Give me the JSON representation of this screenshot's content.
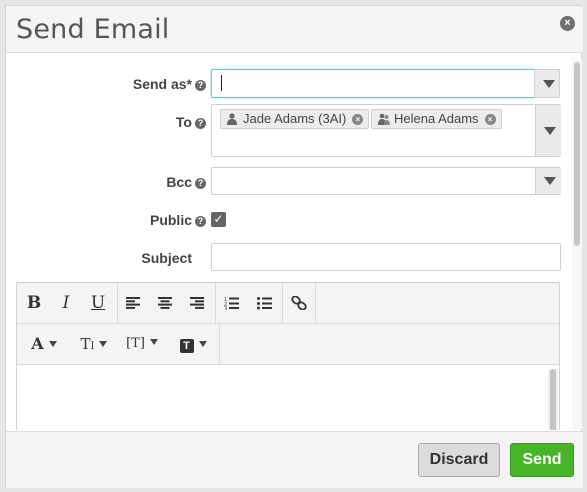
{
  "dialog": {
    "title": "Send Email",
    "close_icon": "close-icon"
  },
  "form": {
    "send_as": {
      "label": "Send as*",
      "value": ""
    },
    "to": {
      "label": "To",
      "recipients": [
        {
          "name": "Jade Adams (3AI)",
          "icon": "person-icon"
        },
        {
          "name": "Helena Adams",
          "icon": "group-icon"
        }
      ]
    },
    "bcc": {
      "label": "Bcc",
      "value": ""
    },
    "public": {
      "label": "Public",
      "checked": true
    },
    "subject": {
      "label": "Subject",
      "value": ""
    },
    "help_glyph": "?",
    "check_glyph": "✓",
    "remove_glyph": "×"
  },
  "toolbar": {
    "bold": "B",
    "italic": "I",
    "underline": "U",
    "font": "A",
    "text_size": "T",
    "insert_field": "[T]",
    "template": "T"
  },
  "footer": {
    "discard_label": "Discard",
    "send_label": "Send"
  },
  "colors": {
    "accent": "#48b42a",
    "focus": "#66c7d6"
  }
}
